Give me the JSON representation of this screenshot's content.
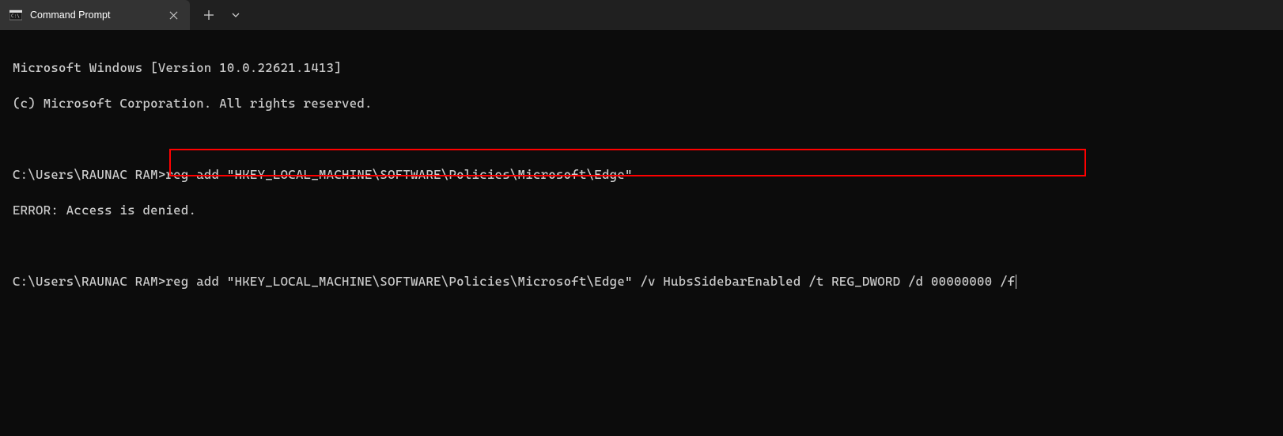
{
  "titlebar": {
    "tab_title": "Command Prompt"
  },
  "terminal": {
    "line1": "Microsoft Windows [Version 10.0.22621.1413]",
    "line2": "(c) Microsoft Corporation. All rights reserved.",
    "blank1": "",
    "prompt1": "C:\\Users\\RAUNAC RAM>",
    "cmd1": "reg add \"HKEY_LOCAL_MACHINE\\SOFTWARE\\Policies\\Microsoft\\Edge\"",
    "error": "ERROR: Access is denied.",
    "blank2": "",
    "prompt2": "C:\\Users\\RAUNAC RAM>",
    "cmd2": "reg add \"HKEY_LOCAL_MACHINE\\SOFTWARE\\Policies\\Microsoft\\Edge\" /v HubsSidebarEnabled /t REG_DWORD /d 00000000 /f"
  }
}
